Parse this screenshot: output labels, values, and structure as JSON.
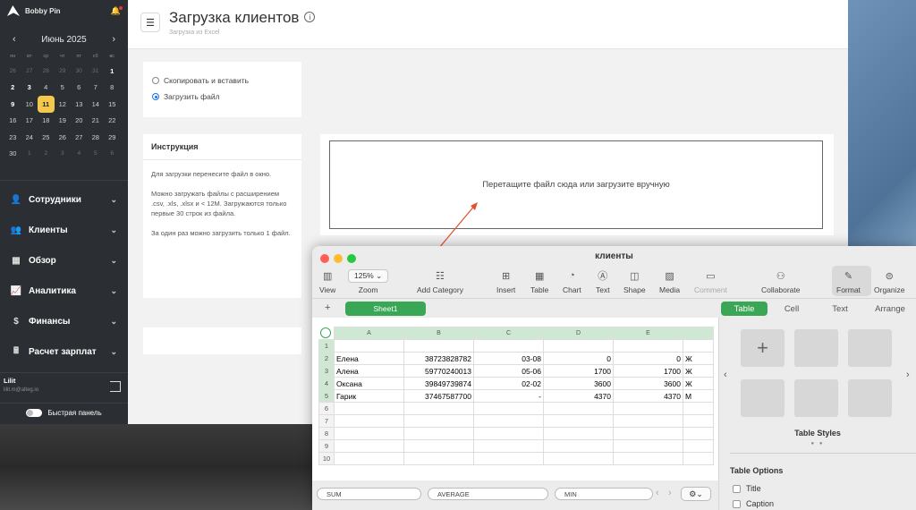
{
  "sidebar": {
    "brand": "Bobby Pin",
    "calendar": {
      "month": "Июнь 2025",
      "weekdays": [
        "пн",
        "вт",
        "ср",
        "чт",
        "пт",
        "сб",
        "вс"
      ],
      "weeks": [
        [
          "26",
          "27",
          "28",
          "29",
          "30",
          "31",
          "1"
        ],
        [
          "2",
          "3",
          "4",
          "5",
          "6",
          "7",
          "8"
        ],
        [
          "9",
          "10",
          "11",
          "12",
          "13",
          "14",
          "15"
        ],
        [
          "16",
          "17",
          "18",
          "19",
          "20",
          "21",
          "22"
        ],
        [
          "23",
          "24",
          "25",
          "26",
          "27",
          "28",
          "29"
        ],
        [
          "30",
          "1",
          "2",
          "3",
          "4",
          "5",
          "6"
        ]
      ],
      "today": "11"
    },
    "nav": [
      {
        "label": "Сотрудники",
        "icon": "user-icon"
      },
      {
        "label": "Клиенты",
        "icon": "users-icon"
      },
      {
        "label": "Обзор",
        "icon": "grid-icon"
      },
      {
        "label": "Аналитика",
        "icon": "chart-icon"
      },
      {
        "label": "Финансы",
        "icon": "dollar-icon"
      },
      {
        "label": "Расчет зарплат",
        "icon": "calculator-icon"
      }
    ],
    "user": {
      "name": "Lilit",
      "email": "lilit.m@alteg.io"
    },
    "quick_panel": "Быстрая панель"
  },
  "header": {
    "title": "Загрузка клиентов",
    "subtitle": "Загрузка из Excel"
  },
  "options": {
    "copy_paste": "Скопировать и вставить",
    "upload_file": "Загрузить файл",
    "selected": "upload_file"
  },
  "instruction": {
    "heading": "Инструкция",
    "p1": "Для загрузки перенесите файл в окно.",
    "p2": "Можно загружать файлы с расширением .csv, .xls, .xlsx и < 12M. Загружаются только первые 30 строк из файла.",
    "p3": "За один раз можно загрузить только 1 файл."
  },
  "dropzone": {
    "text": "Перетащите файл сюда или загрузите вручную"
  },
  "numbers": {
    "window_title": "клиенты",
    "toolbar": {
      "view": "View",
      "zoom_value": "125%",
      "zoom": "Zoom",
      "add_category": "Add Category",
      "insert": "Insert",
      "table": "Table",
      "chart": "Chart",
      "text": "Text",
      "shape": "Shape",
      "media": "Media",
      "comment": "Comment",
      "collaborate": "Collaborate",
      "format": "Format",
      "organize": "Organize"
    },
    "sheet_tab": "Sheet1",
    "panel_tabs": [
      "Table",
      "Cell",
      "Text",
      "Arrange"
    ],
    "columns": [
      "A",
      "B",
      "C",
      "D",
      "E",
      ""
    ],
    "rows": [
      [
        "1",
        "",
        "",
        "",
        "",
        "",
        ""
      ],
      [
        "2",
        "Елена",
        "38723828782",
        "03-08",
        "0",
        "0",
        "Ж"
      ],
      [
        "3",
        "Алена",
        "59770240013",
        "05-06",
        "1700",
        "1700",
        "Ж"
      ],
      [
        "4",
        "Оксана",
        "39849739874",
        "02-02",
        "3600",
        "3600",
        "Ж"
      ],
      [
        "5",
        "Гарик",
        "37467587700",
        "-",
        "4370",
        "4370",
        "М"
      ],
      [
        "6",
        "",
        "",
        "",
        "",
        "",
        ""
      ],
      [
        "7",
        "",
        "",
        "",
        "",
        "",
        ""
      ],
      [
        "8",
        "",
        "",
        "",
        "",
        "",
        ""
      ],
      [
        "9",
        "",
        "",
        "",
        "",
        "",
        ""
      ],
      [
        "10",
        "",
        "",
        "",
        "",
        "",
        ""
      ]
    ],
    "functions": [
      "SUM",
      "AVERAGE",
      "MIN"
    ],
    "format_panel": {
      "table_styles": "Table Styles",
      "table_options": "Table Options",
      "title_option": "Title",
      "caption_option": "Caption"
    }
  }
}
